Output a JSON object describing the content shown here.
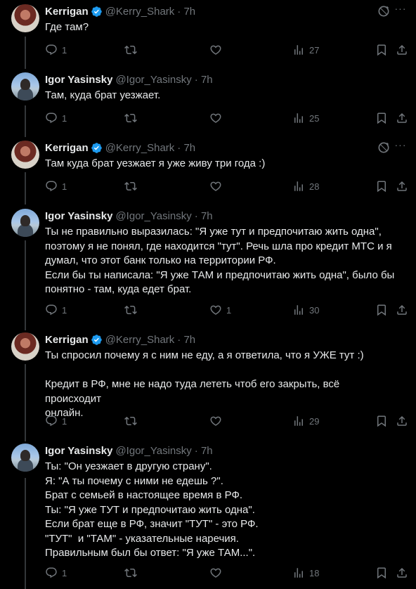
{
  "accounts": {
    "kerrigan": {
      "name": "Kerrigan",
      "handle": "@Kerry_Shark"
    },
    "igor": {
      "name": "Igor Yasinsky",
      "handle": "@Igor_Yasinsky"
    }
  },
  "tweets": [
    {
      "author": "Kerrigan",
      "handle": "@Kerry_Shark",
      "verified": true,
      "time": "· 7h",
      "text": "Где там?",
      "replies": "1",
      "retweets": "",
      "likes": "",
      "views": "27"
    },
    {
      "author": "Igor Yasinsky",
      "handle": "@Igor_Yasinsky",
      "verified": false,
      "time": "· 7h",
      "text": "Там, куда брат уезжает.",
      "replies": "1",
      "retweets": "",
      "likes": "",
      "views": "25"
    },
    {
      "author": "Kerrigan",
      "handle": "@Kerry_Shark",
      "verified": true,
      "time": "· 7h",
      "text": "Там куда брат уезжает я уже живу три года :)",
      "replies": "1",
      "retweets": "",
      "likes": "",
      "views": "28"
    },
    {
      "author": "Igor Yasinsky",
      "handle": "@Igor_Yasinsky",
      "verified": false,
      "time": "· 7h",
      "text": "Ты не правильно выразилась: \"Я уже тут и предпочитаю жить одна\",\nпоэтому я не понял, где находится \"тут\". Речь шла про кредит МТС и я\nдумал, что этот банк только на территории РФ.\nЕсли бы ты написала: \"Я уже ТАМ и предпочитаю жить одна\", было бы\nпонятно - там, куда едет брат.",
      "replies": "1",
      "retweets": "",
      "likes": "1",
      "views": "30"
    },
    {
      "author": "Kerrigan",
      "handle": "@Kerry_Shark",
      "verified": true,
      "time": "· 7h",
      "text": "Ты спросил почему я с ним не еду, а я ответила, что я УЖЕ тут :)\n\nКредит в РФ, мне не надо туда лететь чтоб его закрыть, всё происходит\nонлайн.",
      "replies": "1",
      "retweets": "",
      "likes": "",
      "views": "29"
    },
    {
      "author": "Igor Yasinsky",
      "handle": "@Igor_Yasinsky",
      "verified": false,
      "time": "· 7h",
      "text": "Ты: \"Он уезжает в другую страну\".\nЯ: \"А ты почему с ними не едешь ?\".\nБрат с семьей в настоящее время в РФ.\nТы: \"Я уже ТУТ и предпочитаю жить одна\".\nЕсли брат еще в РФ, значит \"ТУТ\" - это РФ.\n\"ТУТ\"  и \"ТАМ\" - указательные наречия.\nПравильным был бы ответ: \"Я уже ТАМ...\".",
      "replies": "1",
      "retweets": "",
      "likes": "",
      "views": "18"
    }
  ],
  "colors": {
    "background": "#000000",
    "text": "#e7e9ea",
    "muted": "#71767b",
    "verified": "#1d9bf0",
    "thread_line": "#333639"
  },
  "icons": [
    "reply-icon",
    "retweet-icon",
    "like-icon",
    "views-icon",
    "bookmark-icon",
    "share-icon",
    "grok-icon",
    "verified-badge-icon"
  ]
}
